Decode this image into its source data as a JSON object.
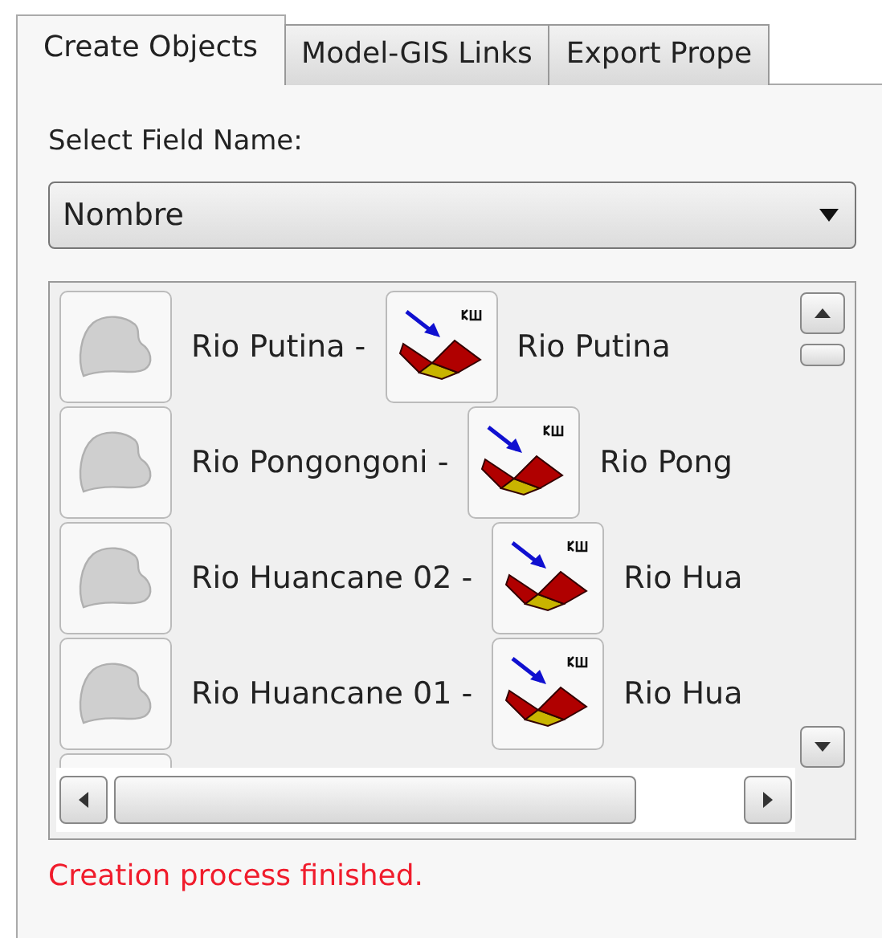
{
  "tabs": [
    {
      "label": "Create Objects",
      "selected": true
    },
    {
      "label": "Model-GIS Links",
      "selected": false
    },
    {
      "label": "Export Prope",
      "selected": false
    }
  ],
  "field_label": "Select Field Name:",
  "dropdown": {
    "value": "Nombre"
  },
  "list": {
    "items": [
      {
        "source": "Rio Putina -",
        "target": "Rio Putina"
      },
      {
        "source": "Rio Pongongoni -",
        "target": "Rio Pong"
      },
      {
        "source": "Rio Huancane 02 -",
        "target": "Rio Hua"
      },
      {
        "source": "Rio Huancane 01 -",
        "target": "Rio Hua"
      }
    ]
  },
  "status": {
    "text": "Creation process finished.",
    "kind": "error"
  }
}
